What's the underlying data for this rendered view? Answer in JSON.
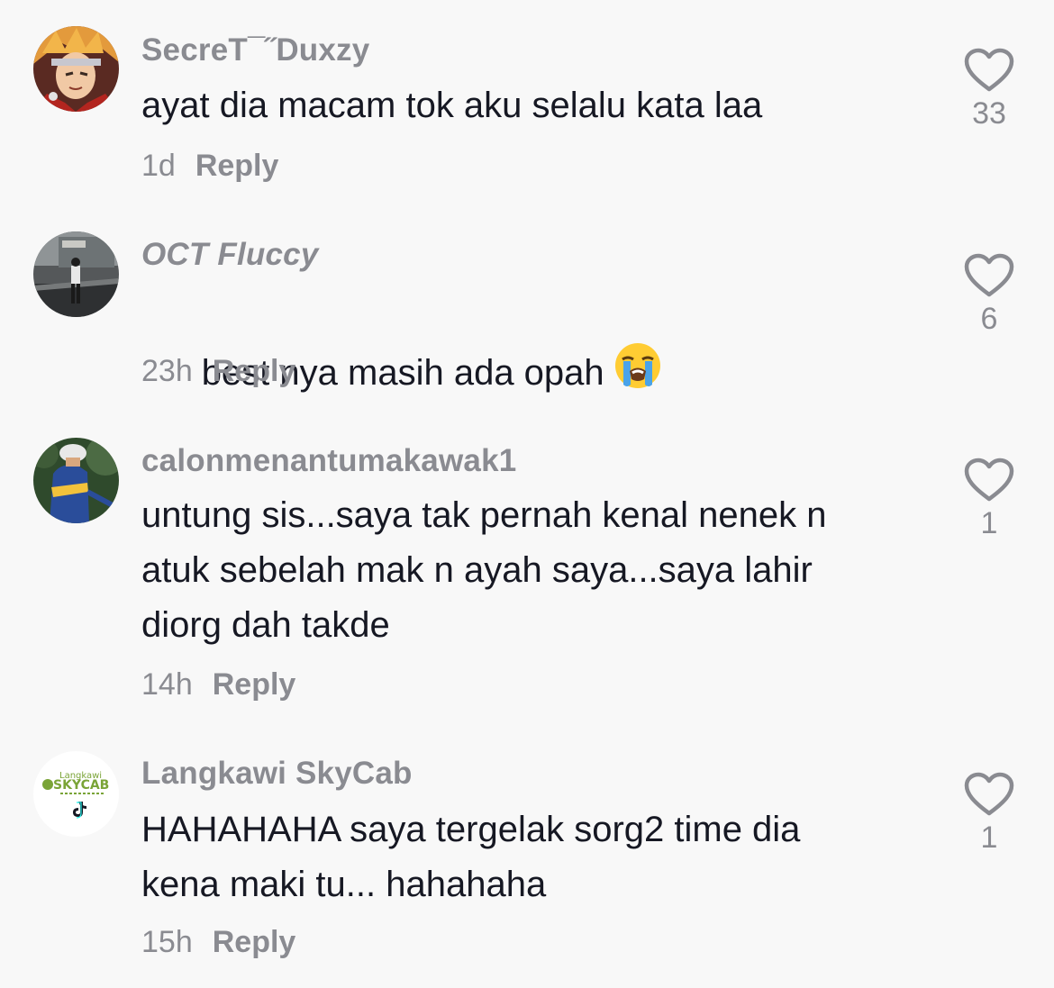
{
  "comments": [
    {
      "username": "SecreT¯˝Duxzy",
      "text": "ayat dia macam tok aku selalu kata laa",
      "time": "1d",
      "reply_label": "Reply",
      "likes": "33",
      "avatar_icon": "anime-character-avatar"
    },
    {
      "username": "OCT Fluccy",
      "text": "best nya masih ada opah",
      "emoji": "loudly-crying-face-emoji",
      "time": "23h",
      "reply_label": "Reply",
      "likes": "6",
      "avatar_icon": "street-photo-avatar"
    },
    {
      "username": "calonmenantumakawak1",
      "text": "untung sis...saya tak pernah kenal nenek n\natuk sebelah mak n ayah saya...saya lahir\ndiorg dah takde",
      "time": "14h",
      "reply_label": "Reply",
      "likes": "1",
      "avatar_icon": "cyclist-photo-avatar"
    },
    {
      "username": "Langkawi SkyCab",
      "text": "HAHAHAHA saya tergelak sorg2 time dia\nkena maki tu... hahahaha",
      "time": "15h",
      "reply_label": "Reply",
      "likes": "1",
      "avatar_icon": "skycab-logo-avatar",
      "avatar_logo": {
        "top_text": "Langkawi",
        "main_text": "SKYCAB"
      }
    }
  ],
  "colors": {
    "background": "#f8f8f8",
    "text": "#161823",
    "muted": "#8a8b91",
    "heart_outline": "#8a8b91",
    "skycab_green": "#7aa437"
  }
}
